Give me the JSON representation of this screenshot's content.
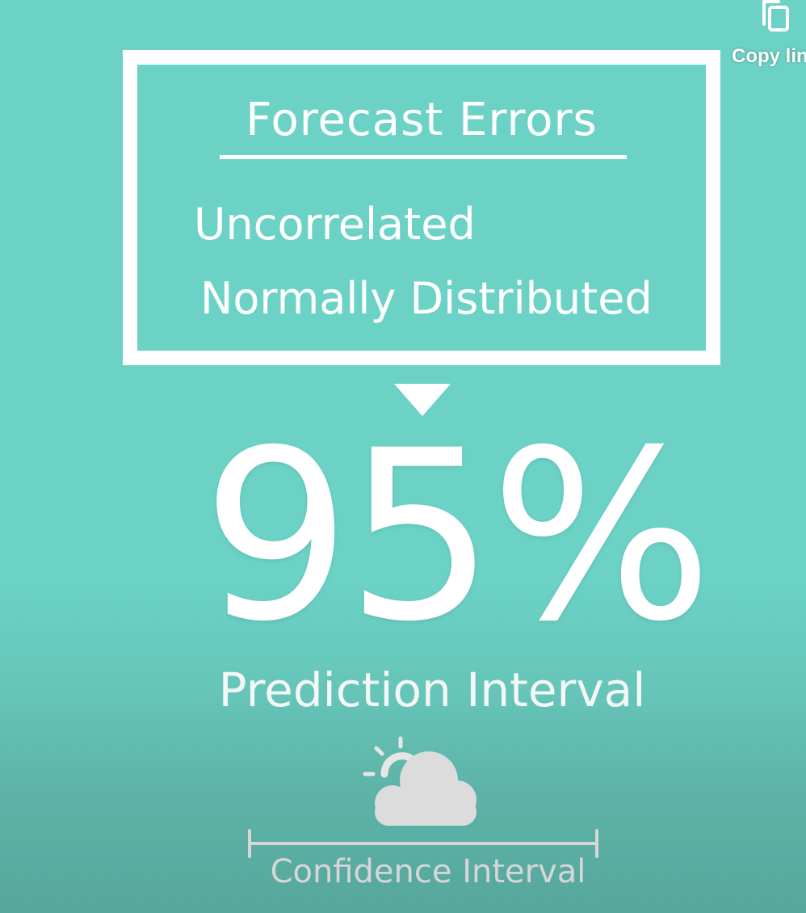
{
  "toolbar": {
    "copy_link_label": "Copy lin",
    "copy_icon": "copy-icon"
  },
  "slide": {
    "box": {
      "title": "Forecast Errors",
      "items": [
        "Uncorrelated",
        "Normally Distributed"
      ]
    },
    "big_value": "95%",
    "big_value_label": "Prediction Interval",
    "weather_icon": "partly-cloudy-icon",
    "bracket_label": "Confidence Interval"
  },
  "colors": {
    "background_top": "#6dd2c6",
    "background_bottom": "#56a79c",
    "foreground": "#ffffff",
    "muted_text": "#d6d6d6"
  }
}
